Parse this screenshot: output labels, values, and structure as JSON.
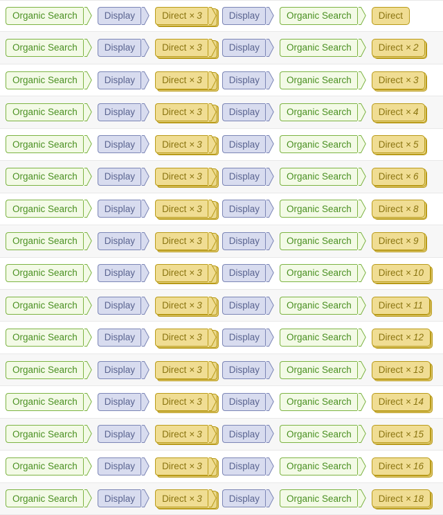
{
  "view": {
    "name": "top-conversion-paths",
    "row_count": 16,
    "columns": 6
  },
  "labels": {
    "organic_search": "Organic Search",
    "display": "Display",
    "direct": "Direct",
    "times_symbol": "×"
  },
  "colors": {
    "organic_search_fill": "#f3fae6",
    "organic_search_border": "#7cb342",
    "organic_search_text": "#4a9021",
    "display_fill": "#d8dcef",
    "display_border": "#7b85b5",
    "display_text": "#5a6490",
    "direct_fill": "#f0dd93",
    "direct_border": "#b89a18",
    "direct_text": "#8a7410",
    "row_background": "#ffffff",
    "row_background_alt": "#f7f7f7",
    "row_separator": "#e8e8e8"
  },
  "rows": [
    {
      "steps": [
        {
          "label": "Organic Search",
          "count": 1,
          "type": "organic",
          "shape": "arrow"
        },
        {
          "label": "Display",
          "count": 1,
          "type": "display",
          "shape": "arrow"
        },
        {
          "label": "Direct",
          "count": 3,
          "type": "direct",
          "shape": "arrow"
        },
        {
          "label": "Display",
          "count": 1,
          "type": "display",
          "shape": "arrow"
        },
        {
          "label": "Organic Search",
          "count": 1,
          "type": "organic",
          "shape": "arrow"
        },
        {
          "label": "Direct",
          "count": 1,
          "type": "direct",
          "shape": "terminal"
        }
      ]
    },
    {
      "steps": [
        {
          "label": "Organic Search",
          "count": 1,
          "type": "organic",
          "shape": "arrow"
        },
        {
          "label": "Display",
          "count": 1,
          "type": "display",
          "shape": "arrow"
        },
        {
          "label": "Direct",
          "count": 3,
          "type": "direct",
          "shape": "arrow"
        },
        {
          "label": "Display",
          "count": 1,
          "type": "display",
          "shape": "arrow"
        },
        {
          "label": "Organic Search",
          "count": 1,
          "type": "organic",
          "shape": "arrow"
        },
        {
          "label": "Direct",
          "count": 2,
          "type": "direct",
          "shape": "terminal"
        }
      ]
    },
    {
      "steps": [
        {
          "label": "Organic Search",
          "count": 1,
          "type": "organic",
          "shape": "arrow"
        },
        {
          "label": "Display",
          "count": 1,
          "type": "display",
          "shape": "arrow"
        },
        {
          "label": "Direct",
          "count": 3,
          "type": "direct",
          "shape": "arrow"
        },
        {
          "label": "Display",
          "count": 1,
          "type": "display",
          "shape": "arrow"
        },
        {
          "label": "Organic Search",
          "count": 1,
          "type": "organic",
          "shape": "arrow"
        },
        {
          "label": "Direct",
          "count": 3,
          "type": "direct",
          "shape": "terminal"
        }
      ]
    },
    {
      "steps": [
        {
          "label": "Organic Search",
          "count": 1,
          "type": "organic",
          "shape": "arrow"
        },
        {
          "label": "Display",
          "count": 1,
          "type": "display",
          "shape": "arrow"
        },
        {
          "label": "Direct",
          "count": 3,
          "type": "direct",
          "shape": "arrow"
        },
        {
          "label": "Display",
          "count": 1,
          "type": "display",
          "shape": "arrow"
        },
        {
          "label": "Organic Search",
          "count": 1,
          "type": "organic",
          "shape": "arrow"
        },
        {
          "label": "Direct",
          "count": 4,
          "type": "direct",
          "shape": "terminal"
        }
      ]
    },
    {
      "steps": [
        {
          "label": "Organic Search",
          "count": 1,
          "type": "organic",
          "shape": "arrow"
        },
        {
          "label": "Display",
          "count": 1,
          "type": "display",
          "shape": "arrow"
        },
        {
          "label": "Direct",
          "count": 3,
          "type": "direct",
          "shape": "arrow"
        },
        {
          "label": "Display",
          "count": 1,
          "type": "display",
          "shape": "arrow"
        },
        {
          "label": "Organic Search",
          "count": 1,
          "type": "organic",
          "shape": "arrow"
        },
        {
          "label": "Direct",
          "count": 5,
          "type": "direct",
          "shape": "terminal"
        }
      ]
    },
    {
      "steps": [
        {
          "label": "Organic Search",
          "count": 1,
          "type": "organic",
          "shape": "arrow"
        },
        {
          "label": "Display",
          "count": 1,
          "type": "display",
          "shape": "arrow"
        },
        {
          "label": "Direct",
          "count": 3,
          "type": "direct",
          "shape": "arrow"
        },
        {
          "label": "Display",
          "count": 1,
          "type": "display",
          "shape": "arrow"
        },
        {
          "label": "Organic Search",
          "count": 1,
          "type": "organic",
          "shape": "arrow"
        },
        {
          "label": "Direct",
          "count": 6,
          "type": "direct",
          "shape": "terminal"
        }
      ]
    },
    {
      "steps": [
        {
          "label": "Organic Search",
          "count": 1,
          "type": "organic",
          "shape": "arrow"
        },
        {
          "label": "Display",
          "count": 1,
          "type": "display",
          "shape": "arrow"
        },
        {
          "label": "Direct",
          "count": 3,
          "type": "direct",
          "shape": "arrow"
        },
        {
          "label": "Display",
          "count": 1,
          "type": "display",
          "shape": "arrow"
        },
        {
          "label": "Organic Search",
          "count": 1,
          "type": "organic",
          "shape": "arrow"
        },
        {
          "label": "Direct",
          "count": 8,
          "type": "direct",
          "shape": "terminal"
        }
      ]
    },
    {
      "steps": [
        {
          "label": "Organic Search",
          "count": 1,
          "type": "organic",
          "shape": "arrow"
        },
        {
          "label": "Display",
          "count": 1,
          "type": "display",
          "shape": "arrow"
        },
        {
          "label": "Direct",
          "count": 3,
          "type": "direct",
          "shape": "arrow"
        },
        {
          "label": "Display",
          "count": 1,
          "type": "display",
          "shape": "arrow"
        },
        {
          "label": "Organic Search",
          "count": 1,
          "type": "organic",
          "shape": "arrow"
        },
        {
          "label": "Direct",
          "count": 9,
          "type": "direct",
          "shape": "terminal"
        }
      ]
    },
    {
      "steps": [
        {
          "label": "Organic Search",
          "count": 1,
          "type": "organic",
          "shape": "arrow"
        },
        {
          "label": "Display",
          "count": 1,
          "type": "display",
          "shape": "arrow"
        },
        {
          "label": "Direct",
          "count": 3,
          "type": "direct",
          "shape": "arrow"
        },
        {
          "label": "Display",
          "count": 1,
          "type": "display",
          "shape": "arrow"
        },
        {
          "label": "Organic Search",
          "count": 1,
          "type": "organic",
          "shape": "arrow"
        },
        {
          "label": "Direct",
          "count": 10,
          "type": "direct",
          "shape": "terminal"
        }
      ]
    },
    {
      "steps": [
        {
          "label": "Organic Search",
          "count": 1,
          "type": "organic",
          "shape": "arrow"
        },
        {
          "label": "Display",
          "count": 1,
          "type": "display",
          "shape": "arrow"
        },
        {
          "label": "Direct",
          "count": 3,
          "type": "direct",
          "shape": "arrow"
        },
        {
          "label": "Display",
          "count": 1,
          "type": "display",
          "shape": "arrow"
        },
        {
          "label": "Organic Search",
          "count": 1,
          "type": "organic",
          "shape": "arrow"
        },
        {
          "label": "Direct",
          "count": 11,
          "type": "direct",
          "shape": "terminal"
        }
      ]
    },
    {
      "steps": [
        {
          "label": "Organic Search",
          "count": 1,
          "type": "organic",
          "shape": "arrow"
        },
        {
          "label": "Display",
          "count": 1,
          "type": "display",
          "shape": "arrow"
        },
        {
          "label": "Direct",
          "count": 3,
          "type": "direct",
          "shape": "arrow"
        },
        {
          "label": "Display",
          "count": 1,
          "type": "display",
          "shape": "arrow"
        },
        {
          "label": "Organic Search",
          "count": 1,
          "type": "organic",
          "shape": "arrow"
        },
        {
          "label": "Direct",
          "count": 12,
          "type": "direct",
          "shape": "terminal"
        }
      ]
    },
    {
      "steps": [
        {
          "label": "Organic Search",
          "count": 1,
          "type": "organic",
          "shape": "arrow"
        },
        {
          "label": "Display",
          "count": 1,
          "type": "display",
          "shape": "arrow"
        },
        {
          "label": "Direct",
          "count": 3,
          "type": "direct",
          "shape": "arrow"
        },
        {
          "label": "Display",
          "count": 1,
          "type": "display",
          "shape": "arrow"
        },
        {
          "label": "Organic Search",
          "count": 1,
          "type": "organic",
          "shape": "arrow"
        },
        {
          "label": "Direct",
          "count": 13,
          "type": "direct",
          "shape": "terminal"
        }
      ]
    },
    {
      "steps": [
        {
          "label": "Organic Search",
          "count": 1,
          "type": "organic",
          "shape": "arrow"
        },
        {
          "label": "Display",
          "count": 1,
          "type": "display",
          "shape": "arrow"
        },
        {
          "label": "Direct",
          "count": 3,
          "type": "direct",
          "shape": "arrow"
        },
        {
          "label": "Display",
          "count": 1,
          "type": "display",
          "shape": "arrow"
        },
        {
          "label": "Organic Search",
          "count": 1,
          "type": "organic",
          "shape": "arrow"
        },
        {
          "label": "Direct",
          "count": 14,
          "type": "direct",
          "shape": "terminal"
        }
      ]
    },
    {
      "steps": [
        {
          "label": "Organic Search",
          "count": 1,
          "type": "organic",
          "shape": "arrow"
        },
        {
          "label": "Display",
          "count": 1,
          "type": "display",
          "shape": "arrow"
        },
        {
          "label": "Direct",
          "count": 3,
          "type": "direct",
          "shape": "arrow"
        },
        {
          "label": "Display",
          "count": 1,
          "type": "display",
          "shape": "arrow"
        },
        {
          "label": "Organic Search",
          "count": 1,
          "type": "organic",
          "shape": "arrow"
        },
        {
          "label": "Direct",
          "count": 15,
          "type": "direct",
          "shape": "terminal"
        }
      ]
    },
    {
      "steps": [
        {
          "label": "Organic Search",
          "count": 1,
          "type": "organic",
          "shape": "arrow"
        },
        {
          "label": "Display",
          "count": 1,
          "type": "display",
          "shape": "arrow"
        },
        {
          "label": "Direct",
          "count": 3,
          "type": "direct",
          "shape": "arrow"
        },
        {
          "label": "Display",
          "count": 1,
          "type": "display",
          "shape": "arrow"
        },
        {
          "label": "Organic Search",
          "count": 1,
          "type": "organic",
          "shape": "arrow"
        },
        {
          "label": "Direct",
          "count": 16,
          "type": "direct",
          "shape": "terminal"
        }
      ]
    },
    {
      "steps": [
        {
          "label": "Organic Search",
          "count": 1,
          "type": "organic",
          "shape": "arrow"
        },
        {
          "label": "Display",
          "count": 1,
          "type": "display",
          "shape": "arrow"
        },
        {
          "label": "Direct",
          "count": 3,
          "type": "direct",
          "shape": "arrow"
        },
        {
          "label": "Display",
          "count": 1,
          "type": "display",
          "shape": "arrow"
        },
        {
          "label": "Organic Search",
          "count": 1,
          "type": "organic",
          "shape": "arrow"
        },
        {
          "label": "Direct",
          "count": 18,
          "type": "direct",
          "shape": "terminal"
        }
      ]
    }
  ]
}
